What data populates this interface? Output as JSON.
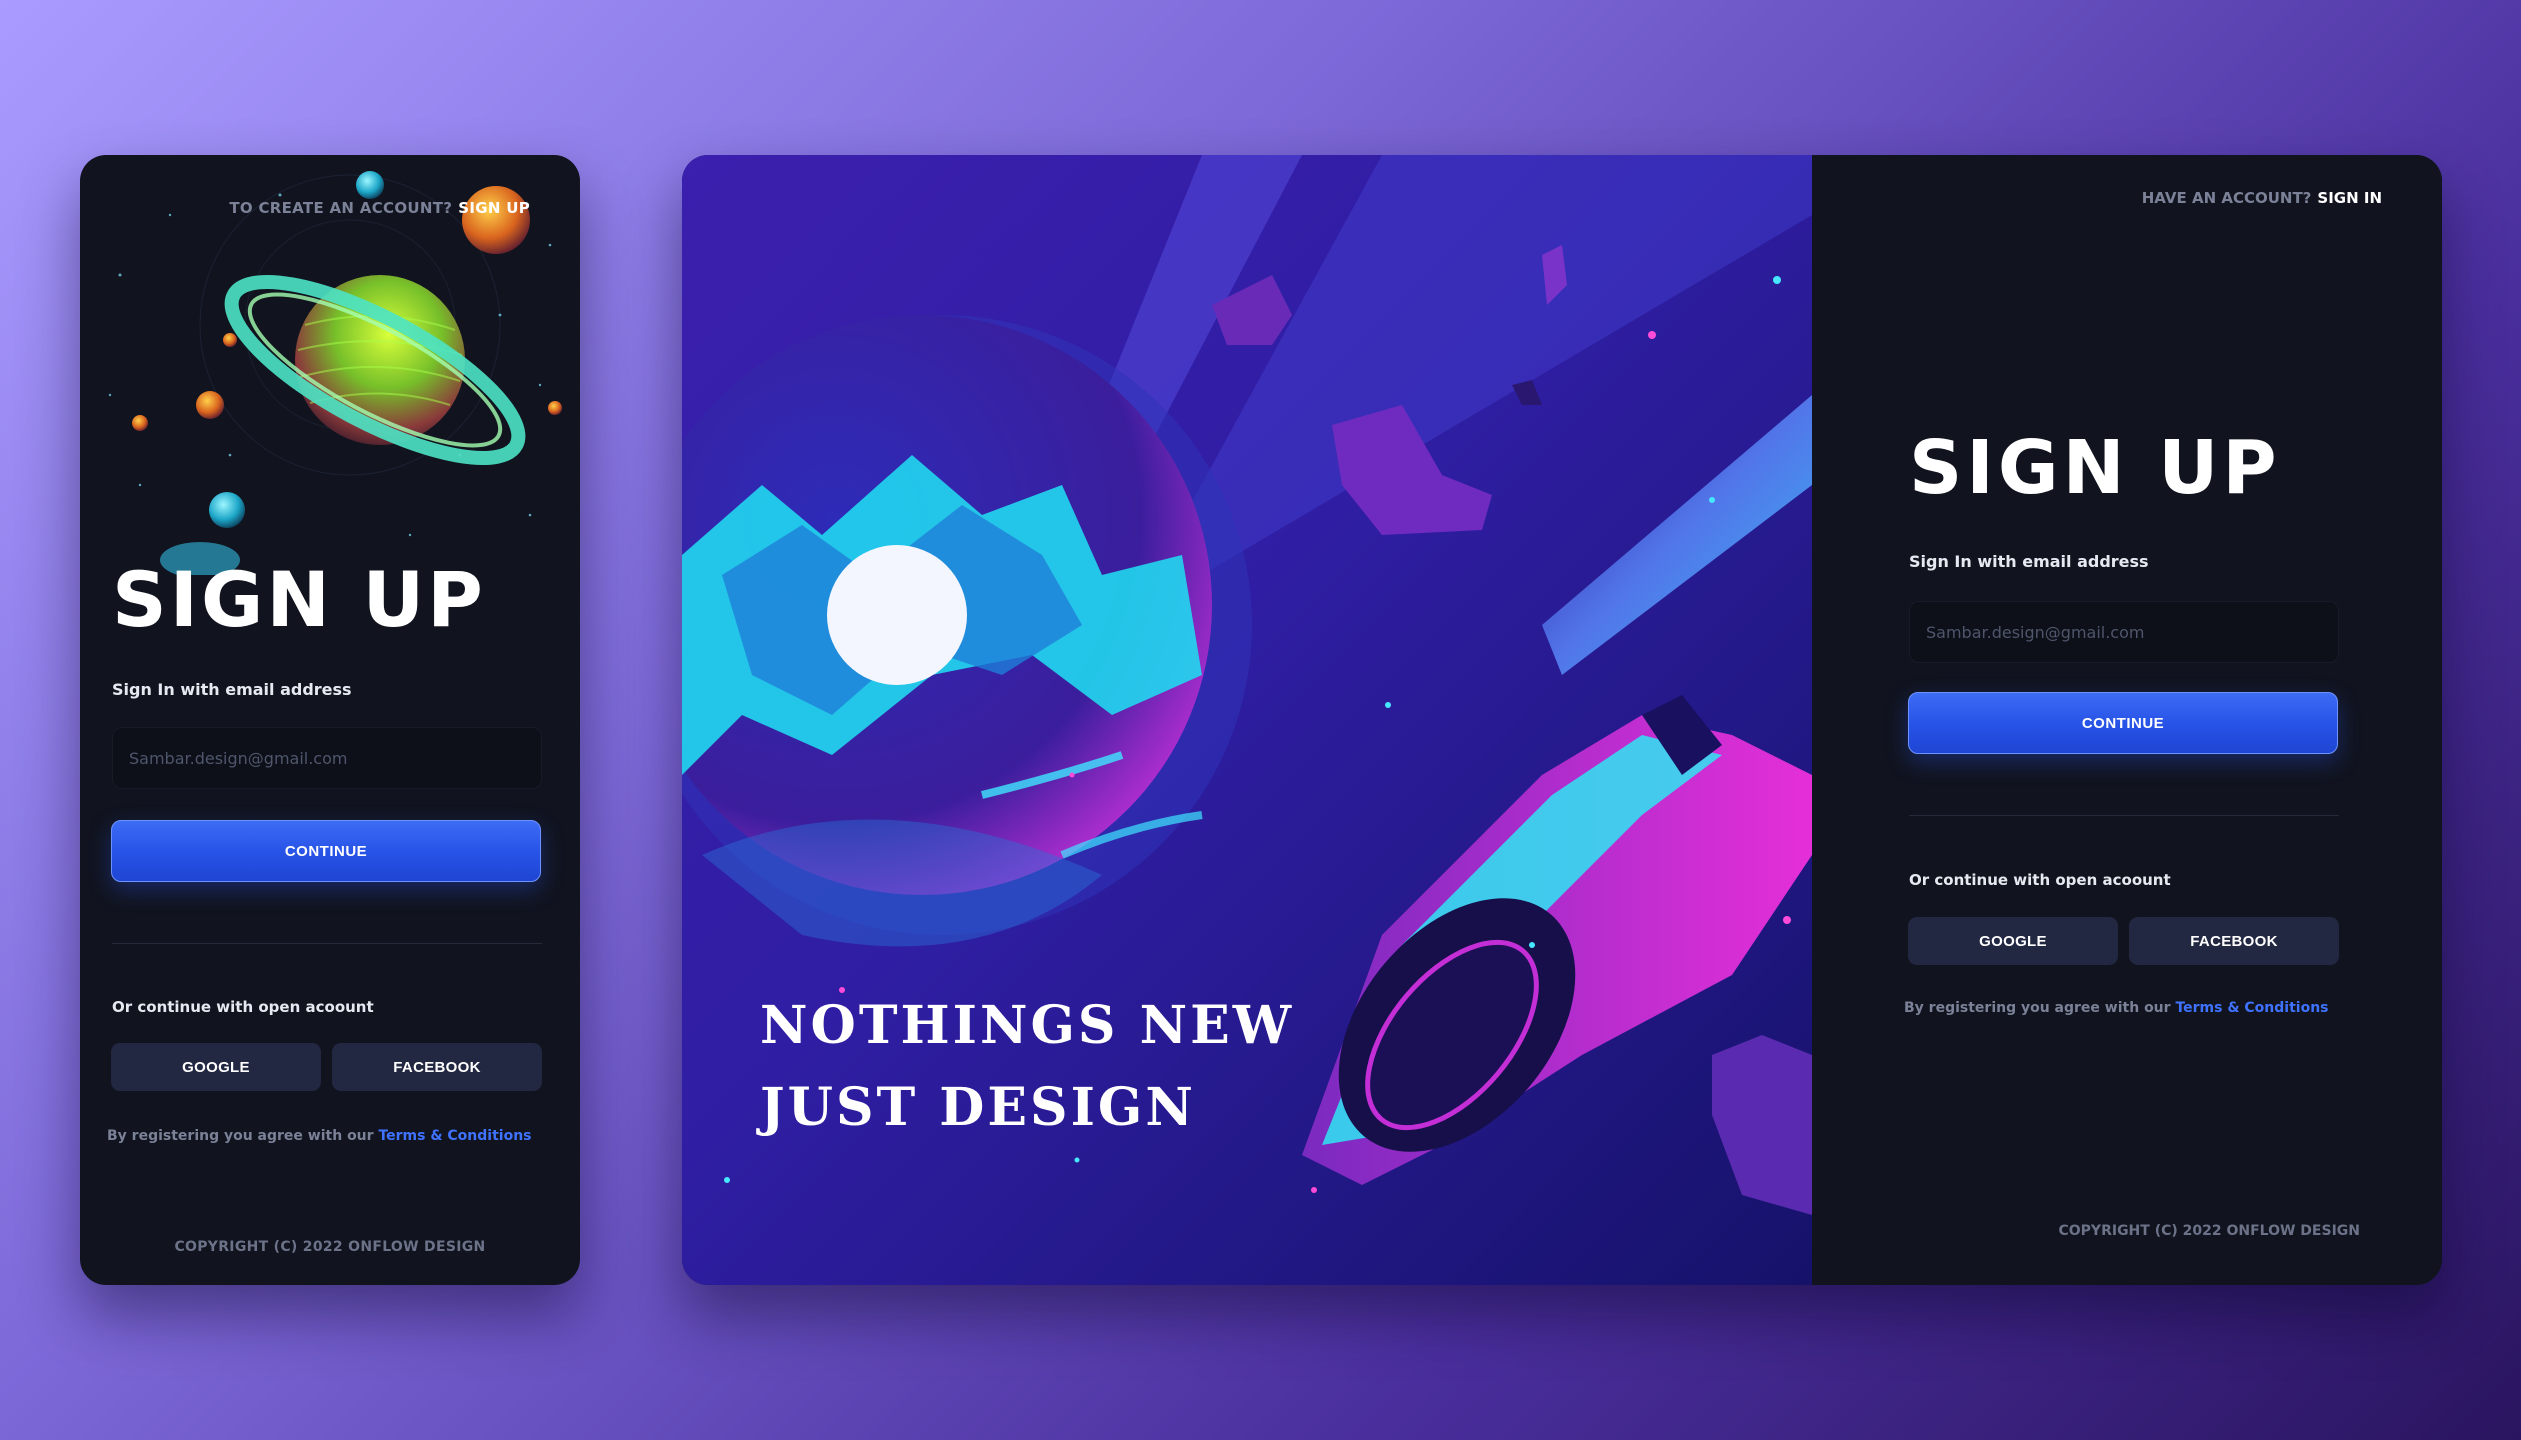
{
  "colors": {
    "accent": "#2f5ef0",
    "link": "#3e72ff",
    "panel": "#11141f",
    "social_button": "#232842"
  },
  "mobile": {
    "top_prompt": "TO CREATE AN ACCOUNT?",
    "top_link": "SIGN UP",
    "title": "SIGN UP",
    "email_label": "Sign In with email address",
    "email_placeholder": "Sambar.design@gmail.com",
    "continue_label": "CONTINUE",
    "or_text": "Or  continue with open  acoount",
    "google_label": "GOOGLE",
    "facebook_label": "FACEBOOK",
    "terms_prefix": "By registering you agree with our",
    "terms_link": "Terms & Conditions",
    "copyright": "COPYRIGHT (C) 2022 ONFLOW DESIGN"
  },
  "desktop": {
    "slogan_line1": "NOTHINGS NEW",
    "slogan_line2": "JUST DESIGN",
    "top_prompt": "HAVE AN ACCOUNT?",
    "top_link": "SIGN IN",
    "title": "SIGN UP",
    "email_label": "Sign In with email address",
    "email_placeholder": "Sambar.design@gmail.com",
    "continue_label": "CONTINUE",
    "or_text": "Or  continue with open  acoount",
    "google_label": "GOOGLE",
    "facebook_label": "FACEBOOK",
    "terms_prefix": "By registering you agree with our",
    "terms_link": "Terms & Conditions",
    "copyright": "COPYRIGHT (C) 2022 ONFLOW DESIGN"
  }
}
